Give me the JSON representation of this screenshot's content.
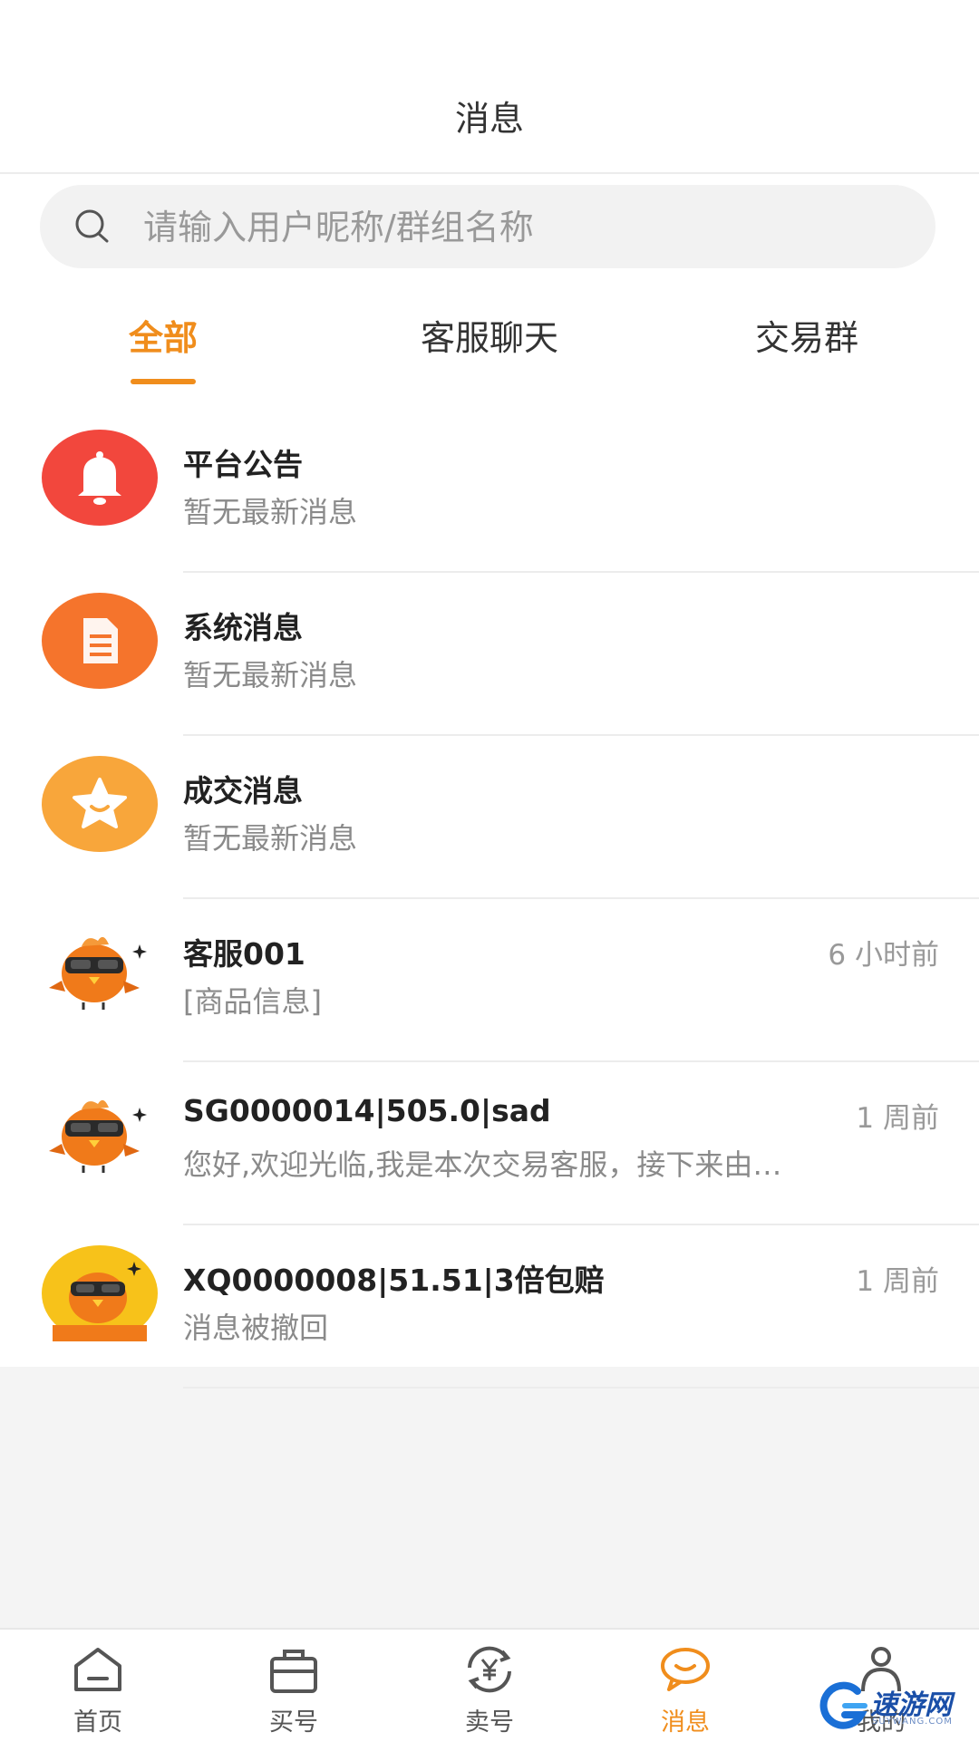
{
  "header": {
    "title": "消息"
  },
  "search": {
    "placeholder": "请输入用户昵称/群组名称",
    "value": ""
  },
  "tabs": [
    {
      "label": "全部",
      "active": true
    },
    {
      "label": "客服聊天",
      "active": false
    },
    {
      "label": "交易群",
      "active": false
    }
  ],
  "conversations": [
    {
      "title": "平台公告",
      "subtitle": "暂无最新消息",
      "time": "",
      "icon": "bell-icon",
      "color": "#f2473d"
    },
    {
      "title": "系统消息",
      "subtitle": "暂无最新消息",
      "time": "",
      "icon": "document-icon",
      "color": "#f5742c"
    },
    {
      "title": "成交消息",
      "subtitle": "暂无最新消息",
      "time": "",
      "icon": "star-icon",
      "color": "#f8a63b"
    },
    {
      "title": "客服001",
      "subtitle": "[商品信息]",
      "time": "6 小时前",
      "icon": "bird-mascot-avatar",
      "color": "#f07a1a"
    },
    {
      "title": "SG0000014|505.0|sad",
      "subtitle": "您好,欢迎光临,我是本次交易客服，接下来由…",
      "time": "1 周前",
      "icon": "bird-mascot-avatar",
      "color": "#f07a1a"
    },
    {
      "title": "XQ0000008|51.51|3倍包赔",
      "subtitle": "消息被撤回",
      "time": "1 周前",
      "icon": "bird-mascot-yellow-avatar",
      "color": "#f7c21a"
    }
  ],
  "nav": [
    {
      "label": "首页",
      "icon": "home-icon",
      "active": false
    },
    {
      "label": "买号",
      "icon": "bag-icon",
      "active": false
    },
    {
      "label": "卖号",
      "icon": "exchange-yen-icon",
      "active": false
    },
    {
      "label": "消息",
      "icon": "chat-bubble-icon",
      "active": true
    },
    {
      "label": "我的",
      "icon": "user-icon",
      "active": false
    }
  ],
  "watermark": {
    "text": "速游网",
    "sub": "SUYWANG.COM"
  },
  "colors": {
    "accent": "#f08d1c"
  }
}
